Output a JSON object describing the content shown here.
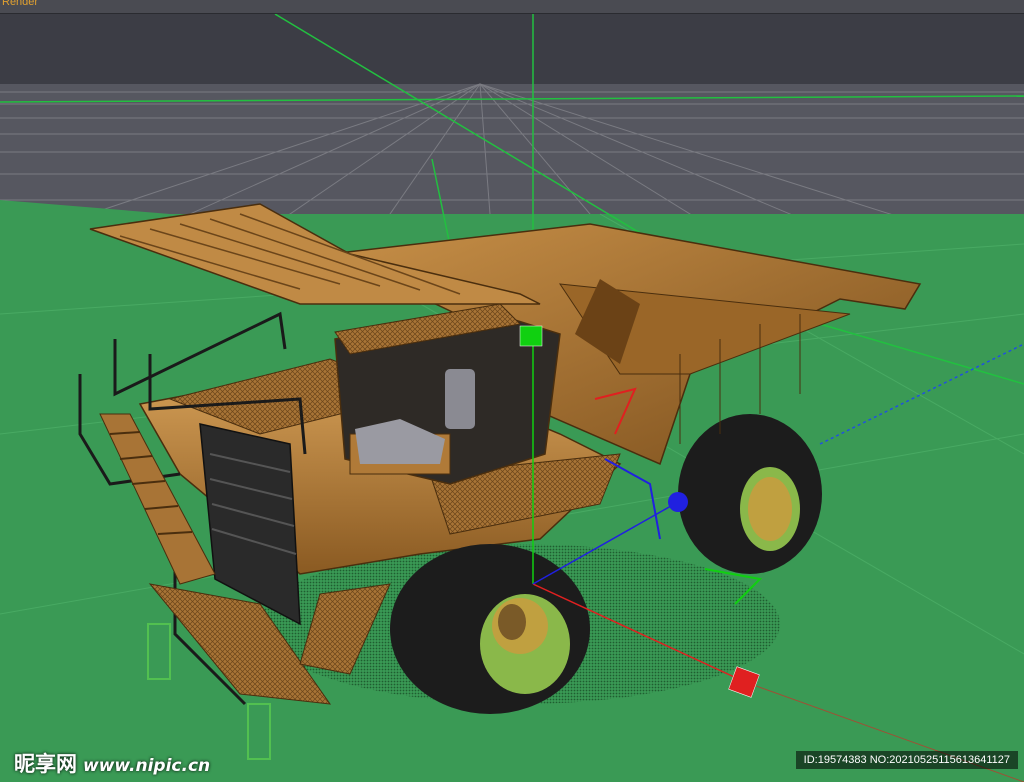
{
  "viewport": {
    "label": "Render",
    "scene": "3D mining dump truck model"
  },
  "colors": {
    "sky": "#3c3d45",
    "floor_grid": "#6a6b72",
    "ground": "#3a9a55",
    "truck_body": "#b8823c",
    "axis_x": "#e02020",
    "axis_y": "#10d010",
    "axis_z": "#2020e0"
  },
  "watermark": {
    "site": "昵享网",
    "url": "www.nipic.cn",
    "id_text": "ID:19574383 NO:20210525115613641127"
  }
}
